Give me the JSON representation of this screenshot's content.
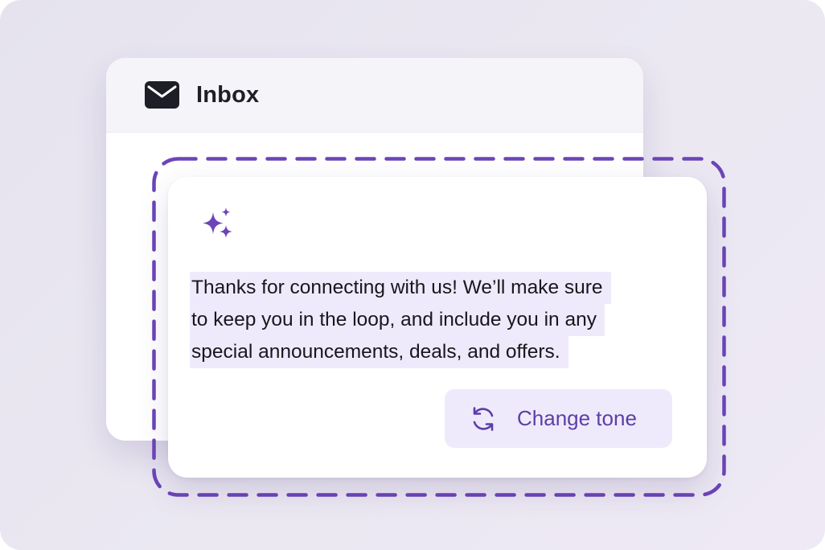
{
  "inbox": {
    "title": "Inbox",
    "icon": "envelope-icon"
  },
  "ai_suggestion": {
    "icon": "sparkle-icon",
    "lines": [
      "Thanks for connecting with us! We’ll make sure",
      "to keep you in the loop, and include you in any",
      "special announcements, deals, and offers."
    ],
    "change_tone_label": "Change tone",
    "change_tone_icon": "refresh-icon"
  },
  "colors": {
    "accent": "#6b45b8",
    "highlight": "#efeafb",
    "background": "#e9e6f0"
  }
}
